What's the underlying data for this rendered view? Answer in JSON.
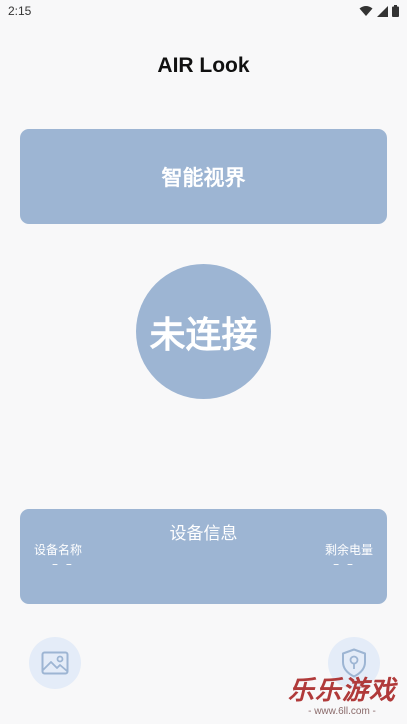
{
  "status_bar": {
    "time": "2:15",
    "icons": [
      "wifi-icon",
      "signal-icon",
      "battery-icon"
    ]
  },
  "header": {
    "title": "AIR Look"
  },
  "mode_card": {
    "label": "智能视界"
  },
  "connection": {
    "status": "未连接"
  },
  "device_info": {
    "title": "设备信息",
    "name_label": "设备名称",
    "name_value": "– –",
    "battery_label": "剩余电量",
    "battery_value": "– –"
  },
  "bottom_buttons": {
    "left_icon": "gallery-icon",
    "right_icon": "shield-icon"
  },
  "watermark": {
    "main": "乐乐游戏",
    "sub": "- www.6ll.com -"
  },
  "colors": {
    "card": "#9db5d3",
    "background": "#f8f8f9",
    "icon_button_bg": "#e4ecf8",
    "icon_stroke": "#9db5d3"
  }
}
